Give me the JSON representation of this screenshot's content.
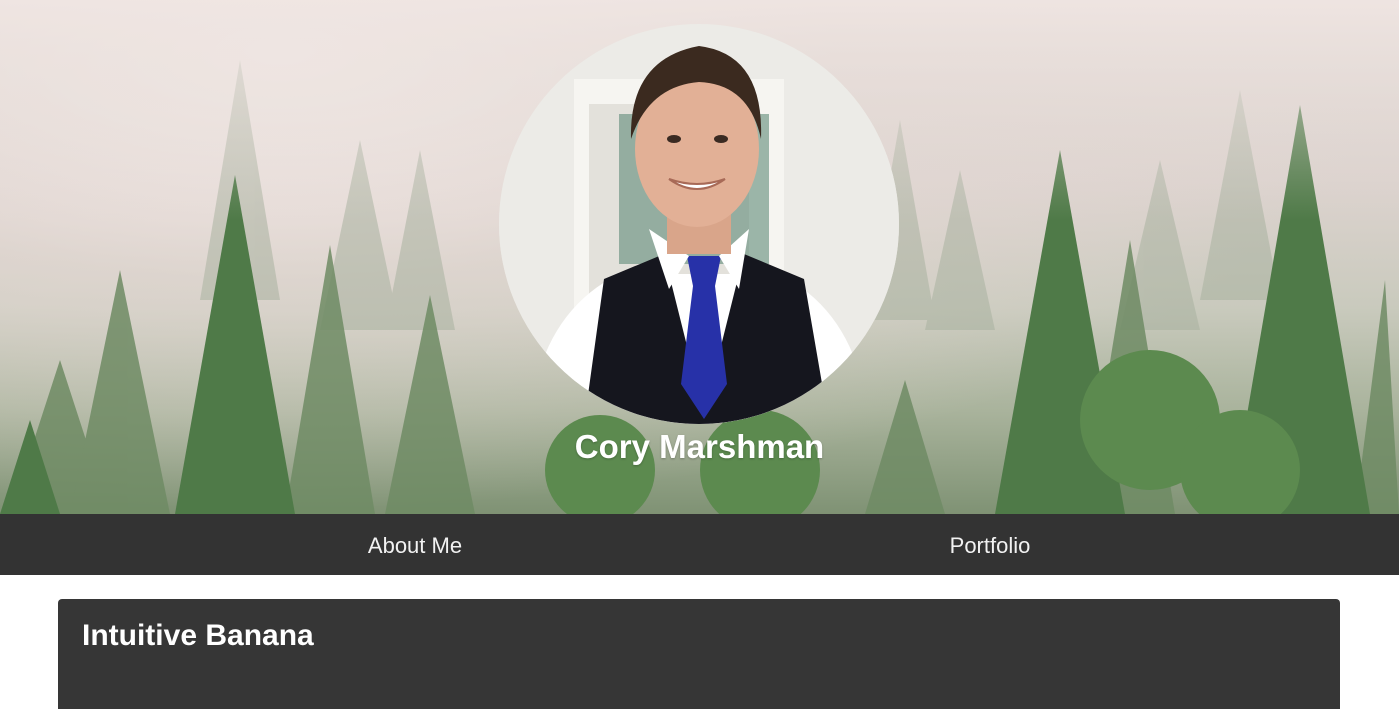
{
  "header": {
    "name": "Cory Marshman",
    "avatar_icon": "profile-photo"
  },
  "nav": {
    "items": [
      {
        "label": "About Me"
      },
      {
        "label": "Portfolio"
      }
    ]
  },
  "main": {
    "card_title": "Intuitive Banana"
  },
  "colors": {
    "navbar": "#333333",
    "card": "#363636",
    "text_light": "#ffffff"
  }
}
